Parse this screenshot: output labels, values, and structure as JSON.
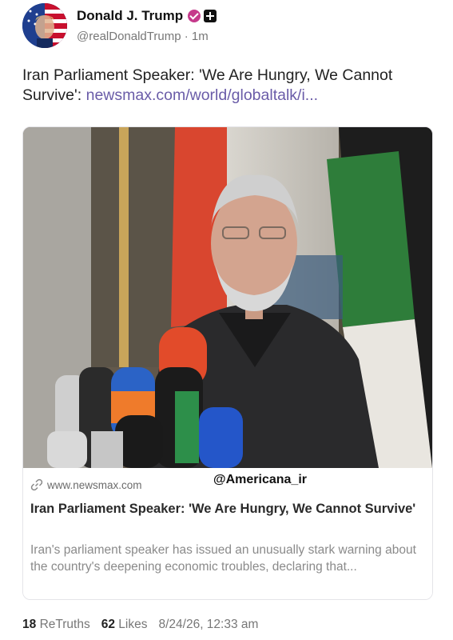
{
  "post": {
    "author": {
      "display_name": "Donald J. Trump",
      "handle": "@realDonaldTrump",
      "separator": "·",
      "time_ago": "1m",
      "avatar_icon": "american-flag-portrait-avatar",
      "verified_icon": "verified-badge-icon",
      "verified_color": "#c53a8b"
    },
    "text": "Iran Parliament Speaker: 'We Are Hungry, We Cannot Survive': ",
    "link_text": "newsmax.com/world/globaltalk/i...",
    "link_color": "#6a5ca8"
  },
  "card": {
    "image_description_icon": "press-conference-photo",
    "domain": "www.newsmax.com",
    "watermark": "@Americana_ir",
    "title": "Iran Parliament Speaker: 'We Are Hungry, We Cannot Survive'",
    "description": "Iran's parliament speaker has issued an unusually stark warning about the country's deepening economic troubles, declaring that..."
  },
  "stats": {
    "retruths_count": "18",
    "retruths_label": "ReTruths",
    "likes_count": "62",
    "likes_label": "Likes",
    "timestamp": "8/24/26, 12:33 am"
  }
}
